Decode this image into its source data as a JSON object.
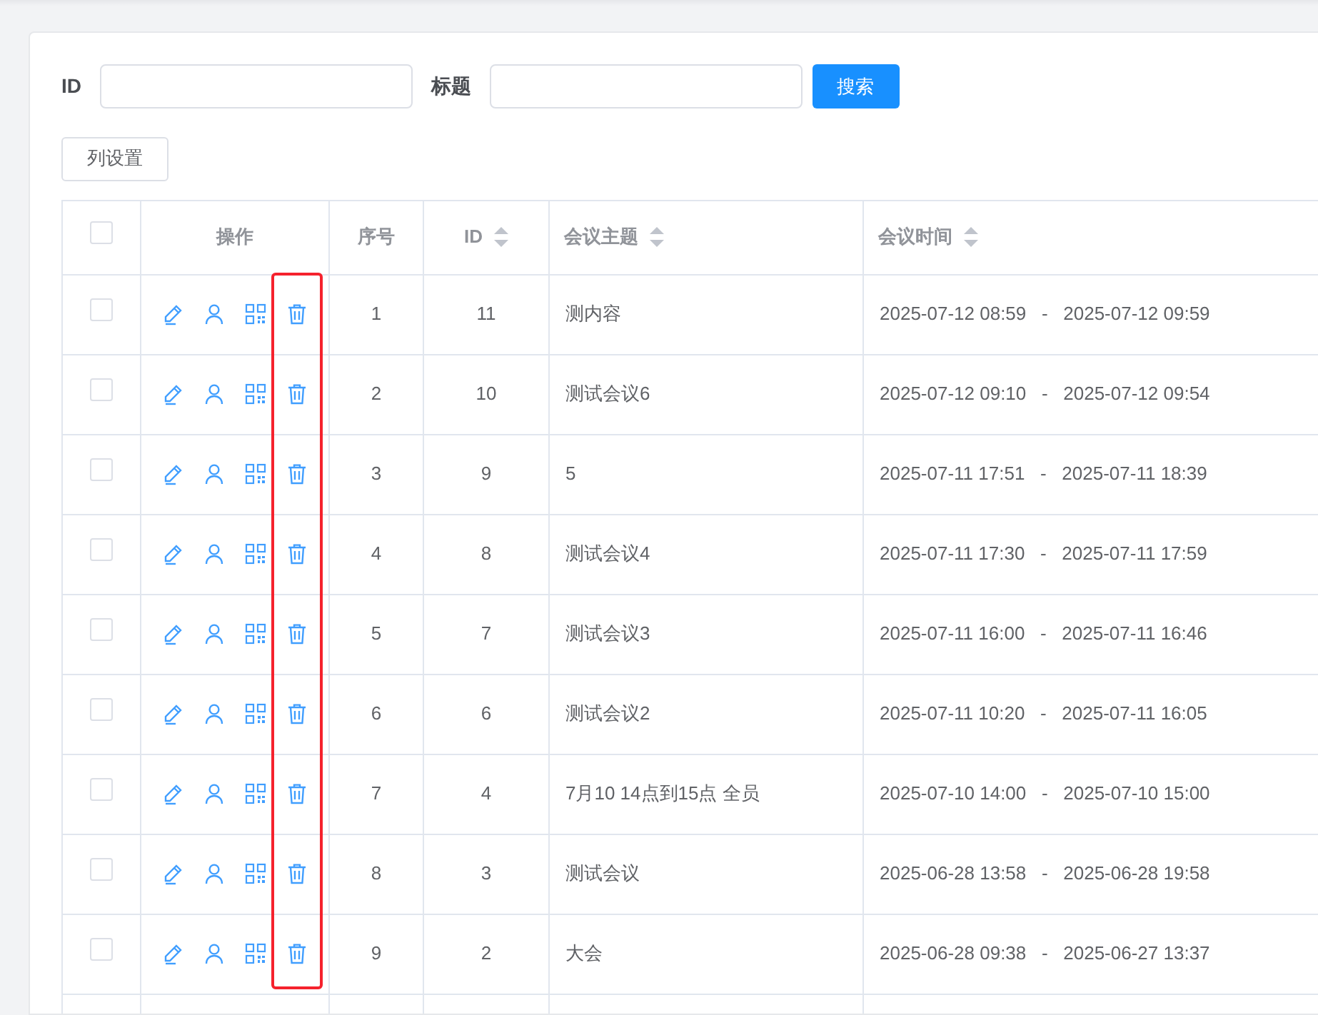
{
  "filters": [
    {
      "label": "ID"
    },
    {
      "label": "标题"
    }
  ],
  "search_button": "搜索",
  "column_settings_button": "列设置",
  "table": {
    "select_all": {
      "checked": false
    },
    "columns": [
      {
        "kind": "actions",
        "label": "操作",
        "sortable": false
      },
      {
        "kind": "index",
        "label": "序号",
        "sortable": false
      },
      {
        "kind": "id",
        "label": "ID",
        "sortable": true
      },
      {
        "kind": "topic",
        "label": "会议主题",
        "sortable": true
      },
      {
        "kind": "time",
        "label": "会议时间",
        "sortable": true
      }
    ],
    "actions": [
      {
        "kind": "edit",
        "highlighted": false
      },
      {
        "kind": "person",
        "highlighted": false
      },
      {
        "kind": "grid",
        "highlighted": false
      },
      {
        "kind": "delete",
        "highlighted": true
      }
    ],
    "rows": [
      {
        "checked": false,
        "index": "1",
        "id": "11",
        "topic": "测内容",
        "time": "2025-07-12 08:59   -   2025-07-12 09:59"
      },
      {
        "checked": false,
        "index": "2",
        "id": "10",
        "topic": "测试会议6",
        "time": "2025-07-12 09:10   -   2025-07-12 09:54"
      },
      {
        "checked": false,
        "index": "3",
        "id": "9",
        "topic": "5",
        "time": "2025-07-11 17:51   -   2025-07-11 18:39"
      },
      {
        "checked": false,
        "index": "4",
        "id": "8",
        "topic": "测试会议4",
        "time": "2025-07-11 17:30   -   2025-07-11 17:59"
      },
      {
        "checked": false,
        "index": "5",
        "id": "7",
        "topic": "测试会议3",
        "time": "2025-07-11 16:00   -   2025-07-11 16:46"
      },
      {
        "checked": false,
        "index": "6",
        "id": "6",
        "topic": "测试会议2",
        "time": "2025-07-11 10:20   -   2025-07-11 16:05"
      },
      {
        "checked": false,
        "index": "7",
        "id": "4",
        "topic": "7月10 14点到15点 全员",
        "time": "2025-07-10 14:00   -   2025-07-10 15:00"
      },
      {
        "checked": false,
        "index": "8",
        "id": "3",
        "topic": "测试会议",
        "time": "2025-06-28 13:58   -   2025-06-28 19:58"
      },
      {
        "checked": false,
        "index": "9",
        "id": "2",
        "topic": "大会",
        "time": "2025-06-28 09:38   -   2025-06-27 13:37"
      }
    ]
  }
}
